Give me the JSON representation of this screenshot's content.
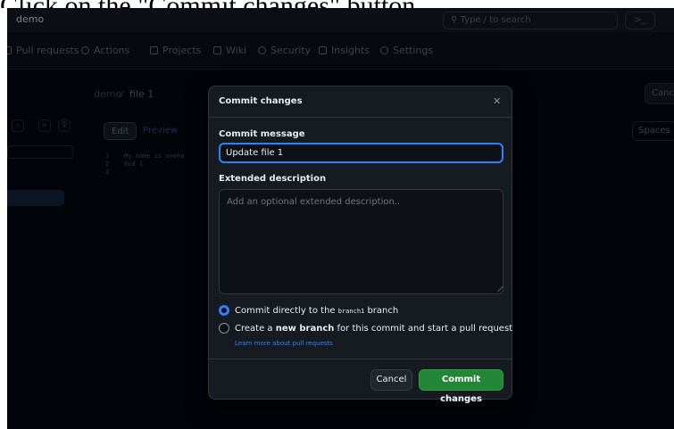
{
  "caption": "Click on the \"Commit changes\" button.",
  "topbar": {
    "repo": "demo",
    "search_placeholder": "Type / to search",
    "terminal": ">_"
  },
  "nav": {
    "items": [
      "Pull requests",
      "Actions",
      "Projects",
      "Wiki",
      "Security",
      "Insights",
      "Settings"
    ]
  },
  "breadcrumb": {
    "repo": "demo",
    "separator": "/",
    "file": "file 1"
  },
  "editor": {
    "tabs": [
      "Edit",
      "Preview"
    ],
    "lines": [
      "1    My name is sneha",
      "2    bcd 1",
      "3"
    ],
    "spaces_label": "Spaces",
    "cancel_label": "Cance"
  },
  "modal": {
    "title": "Commit changes",
    "close_icon": "close-icon",
    "message_label": "Commit message",
    "message_value": "Update file 1",
    "description_label": "Extended description",
    "description_placeholder": "Add an optional extended description..",
    "option1_prefix": "Commit directly to the",
    "option1_branch": "branch1",
    "option1_suffix": "branch",
    "option2_prefix": "Create a",
    "option2_bold": "new branch",
    "option2_suffix": "for this commit and start a pull request",
    "learn_more": "Learn more about pull requests",
    "cancel_label": "Cancel",
    "commit_label": "Commit changes",
    "accent": "#2f81f7",
    "commit_color": "#238636"
  }
}
